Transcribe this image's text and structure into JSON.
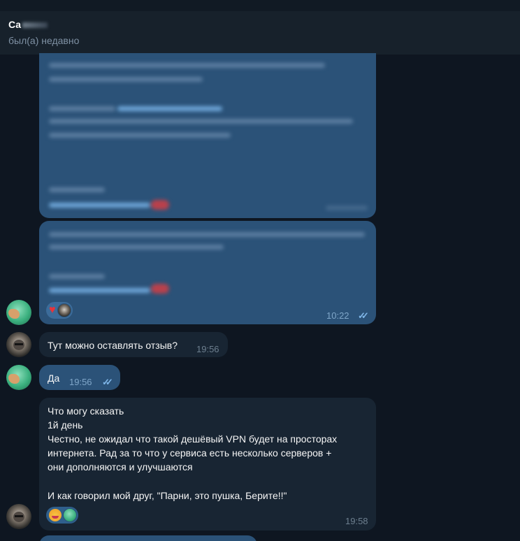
{
  "header": {
    "contact_name": "Са",
    "status": "был(а) недавно"
  },
  "messages": [
    {
      "id": "m1",
      "direction": "outgoing",
      "content": "blurred"
    },
    {
      "id": "m2",
      "direction": "outgoing",
      "content": "blurred",
      "reactions": [
        "heart",
        "user-avatar"
      ],
      "time": "10:22",
      "read": true,
      "check_glyph": "✓✓"
    },
    {
      "id": "m3",
      "direction": "incoming",
      "text": "Тут можно оставлять отзыв?",
      "time": "19:56"
    },
    {
      "id": "m4",
      "direction": "outgoing",
      "text": "Да",
      "time": "19:56",
      "read": true,
      "check_glyph": "✓✓"
    },
    {
      "id": "m5",
      "direction": "incoming",
      "lines": [
        "Что могу сказать",
        "1й день",
        "Честно, не ожидал что такой дешёвый VPN будет на просторах",
        "интернета. Рад за то что у сервиса есть несколько серверов +",
        "они дополняются и улучшаются",
        "",
        "И как говорил мой друг, \"Парни, это пушка, Берите!!\""
      ],
      "reactions": [
        "smiling-face-with-hearts",
        "user-avatar"
      ],
      "time": "19:58"
    }
  ],
  "icons": {
    "heart": "♥",
    "double_check": "✓✓"
  },
  "colors": {
    "background": "#0e1621",
    "header": "#17212b",
    "outgoing_bubble": "#2b5278",
    "incoming_bubble": "#182533",
    "accent_link": "#6ea6d8",
    "time_outgoing": "#7fa6c9",
    "time_incoming": "#6d7f8f"
  }
}
